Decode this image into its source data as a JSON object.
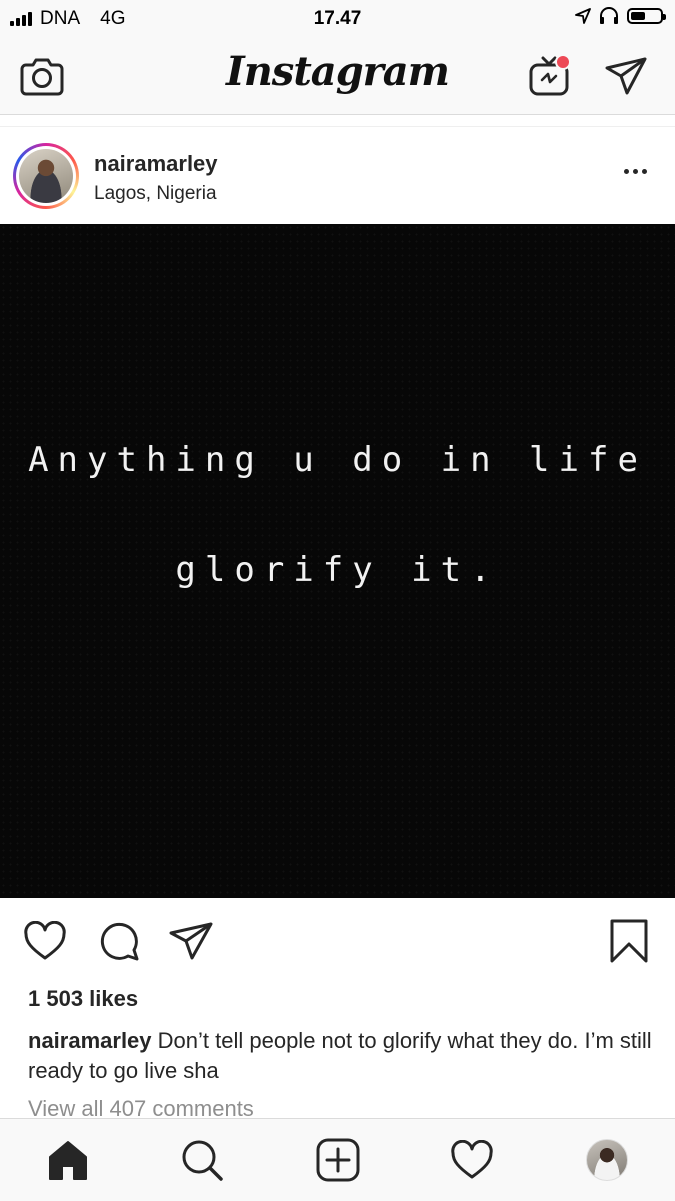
{
  "status_bar": {
    "carrier": "DNA",
    "network": "4G",
    "time": "17.47"
  },
  "header": {
    "logo_text": "Instagram",
    "icons": [
      "camera-icon",
      "igtv-icon",
      "direct-message-icon"
    ],
    "notification_dot_color": "#ed4956"
  },
  "post": {
    "username": "nairamarley",
    "location": "Lagos, Nigeria",
    "image_text": {
      "line1": "Anything u do in life",
      "line2": "glorify it."
    },
    "likes": "1 503 likes",
    "caption_username": "nairamarley",
    "caption_text": "Don’t tell people not to glorify what they do. I’m still ready to go live sha",
    "view_comments": "View all 407 comments"
  },
  "actions": [
    "heart-icon",
    "comment-icon",
    "share-icon",
    "bookmark-icon"
  ],
  "tabbar": [
    "home-icon",
    "search-icon",
    "new-post-icon",
    "activity-icon",
    "profile-avatar"
  ],
  "colors": {
    "text": "#262626",
    "muted": "#8e8e8e",
    "bar_background": "#f9f9f9",
    "post_background": "#070707"
  }
}
